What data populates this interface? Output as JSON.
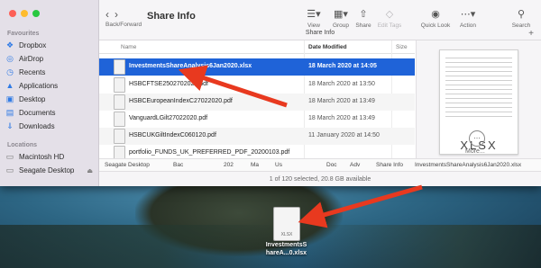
{
  "window": {
    "title": "Share Info",
    "nav_label": "Back/Forward",
    "path_label": "Share Info"
  },
  "sidebar": {
    "favourites_label": "Favourites",
    "favourites": [
      {
        "label": "Dropbox",
        "icon": "dropbox-icon"
      },
      {
        "label": "AirDrop",
        "icon": "airdrop-icon"
      },
      {
        "label": "Recents",
        "icon": "clock-icon"
      },
      {
        "label": "Applications",
        "icon": "applications-icon"
      },
      {
        "label": "Desktop",
        "icon": "desktop-icon"
      },
      {
        "label": "Documents",
        "icon": "document-icon"
      },
      {
        "label": "Downloads",
        "icon": "download-icon"
      }
    ],
    "locations_label": "Locations",
    "locations": [
      {
        "label": "Macintosh HD",
        "icon": "disk-icon"
      },
      {
        "label": "Seagate Desktop",
        "icon": "disk-icon"
      }
    ]
  },
  "toolbar": {
    "view": "View",
    "group": "Group",
    "share": "Share",
    "edit_tags": "Edit Tags",
    "quick_look": "Quick Look",
    "action": "Action",
    "search": "Search"
  },
  "columns": {
    "name": "Name",
    "date": "Date Modified",
    "size": "Size"
  },
  "files": [
    {
      "name": "InvestmentsShareAnalysis6Jan2020.xlsx",
      "date": "18 March 2020 at 14:05",
      "size": "",
      "selected": true
    },
    {
      "name": "HSBCFTSE2502702020.pdf",
      "date": "18 March 2020 at 13:50",
      "size": "",
      "selected": false
    },
    {
      "name": "HSBCEuropeanIndexC27022020.pdf",
      "date": "18 March 2020 at 13:49",
      "size": "",
      "selected": false
    },
    {
      "name": "VanguardLGilt27022020.pdf",
      "date": "18 March 2020 at 13:49",
      "size": "",
      "selected": false
    },
    {
      "name": "HSBCUKGiltIndexC060120.pdf",
      "date": "11 January 2020 at 14:50",
      "size": "",
      "selected": false
    },
    {
      "name": "portfolio_FUNDS_UK_PREFERRED_PDF_20200103.pdf",
      "date": "",
      "size": "",
      "selected": false
    }
  ],
  "preview": {
    "ext": "XLSX",
    "more": "More..."
  },
  "pathbar": {
    "items": [
      "Seagate Desktop",
      "Bac",
      "",
      "202",
      "Ma",
      "Us",
      "",
      "Doc",
      "Adv",
      "Share Info",
      "InvestmentsShareAnalysis6Jan2020.xlsx"
    ]
  },
  "status": "1 of 120 selected, 20.8 GB available",
  "desktop_icon": {
    "ext": "XLSX",
    "label_line1": "InvestmentsS",
    "label_line2": "hareA...0.xlsx"
  },
  "colors": {
    "selection": "#1f63d8",
    "arrow": "#e8391f"
  }
}
